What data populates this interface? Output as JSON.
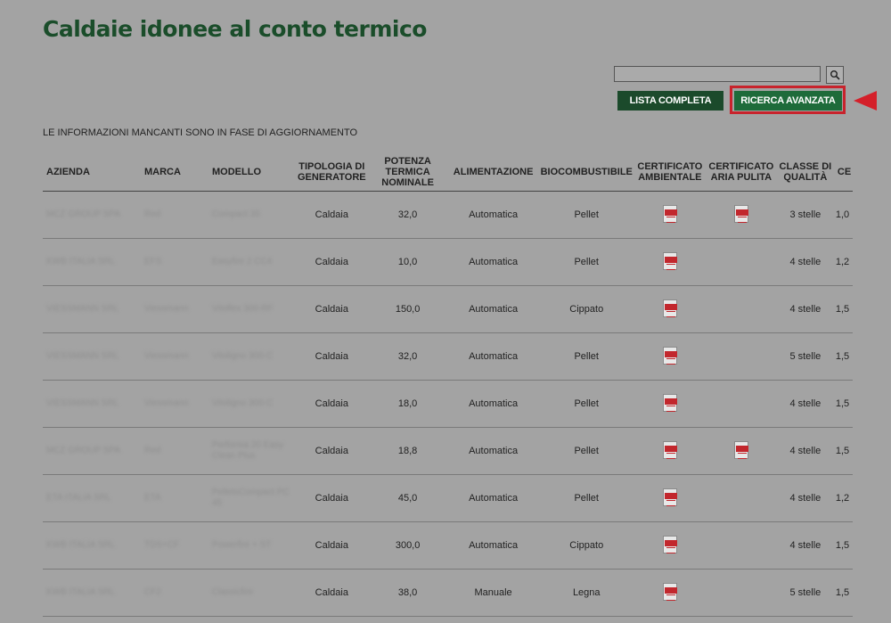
{
  "page": {
    "title": "Caldaie idonee al conto termico",
    "notice": "LE INFORMAZIONI MANCANTI SONO IN FASE DI AGGIORNAMENTO"
  },
  "search": {
    "value": "",
    "placeholder": "",
    "button_icon": "magnifier-icon"
  },
  "buttons": {
    "lista": "LISTA COMPLETA",
    "ricerca": "RICERCA AVANZATA"
  },
  "colors": {
    "brand_green": "#1b4a2b",
    "highlight_red": "#c8232c",
    "background": "#a3a3a3"
  },
  "table": {
    "headers": {
      "azienda": "AZIENDA",
      "marca": "MARCA",
      "modello": "MODELLO",
      "tipologia": "TIPOLOGIA DI GENERATORE",
      "potenza": "POTENZA TERMICA NOMINALE",
      "alimentazione": "ALIMENTAZIONE",
      "biocombustibile": "BIOCOMBUSTIBILE",
      "cert_ambientale": "CERTIFICATO AMBIENTALE",
      "cert_aria": "CERTIFICATO ARIA PULITA",
      "classe": "CLASSE DI QUALITÀ",
      "ce": "CE"
    },
    "rows": [
      {
        "azienda": "MCZ GROUP SPA",
        "marca": "Red",
        "modello": "Compact 35",
        "tipologia": "Caldaia",
        "potenza": "32,0",
        "alimentazione": "Automatica",
        "biocombustibile": "Pellet",
        "cert_ambientale": true,
        "cert_aria": true,
        "classe": "3 stelle",
        "ce": "1,0"
      },
      {
        "azienda": "KWB ITALIA SRL",
        "marca": "EFS",
        "modello": "Easyfire 2 CC4",
        "tipologia": "Caldaia",
        "potenza": "10,0",
        "alimentazione": "Automatica",
        "biocombustibile": "Pellet",
        "cert_ambientale": true,
        "cert_aria": false,
        "classe": "4 stelle",
        "ce": "1,2"
      },
      {
        "azienda": "VIESSMANN SRL",
        "marca": "Viessmann",
        "modello": "Vitoflex 300-RF",
        "tipologia": "Caldaia",
        "potenza": "150,0",
        "alimentazione": "Automatica",
        "biocombustibile": "Cippato",
        "cert_ambientale": true,
        "cert_aria": false,
        "classe": "4 stelle",
        "ce": "1,5"
      },
      {
        "azienda": "VIESSMANN SRL",
        "marca": "Viessmann",
        "modello": "Vitoligno 300-C",
        "tipologia": "Caldaia",
        "potenza": "32,0",
        "alimentazione": "Automatica",
        "biocombustibile": "Pellet",
        "cert_ambientale": true,
        "cert_aria": false,
        "classe": "5 stelle",
        "ce": "1,5"
      },
      {
        "azienda": "VIESSMANN SRL",
        "marca": "Viessmann",
        "modello": "Vitoligno 300-C",
        "tipologia": "Caldaia",
        "potenza": "18,0",
        "alimentazione": "Automatica",
        "biocombustibile": "Pellet",
        "cert_ambientale": true,
        "cert_aria": false,
        "classe": "4 stelle",
        "ce": "1,5"
      },
      {
        "azienda": "MCZ GROUP SPA",
        "marca": "Red",
        "modello": "Performa 20 Easy Clean Plus",
        "tipologia": "Caldaia",
        "potenza": "18,8",
        "alimentazione": "Automatica",
        "biocombustibile": "Pellet",
        "cert_ambientale": true,
        "cert_aria": true,
        "classe": "4 stelle",
        "ce": "1,5"
      },
      {
        "azienda": "ETA ITALIA SRL",
        "marca": "ETA",
        "modello": "PelletsCompact PC 45",
        "tipologia": "Caldaia",
        "potenza": "45,0",
        "alimentazione": "Automatica",
        "biocombustibile": "Pellet",
        "cert_ambientale": true,
        "cert_aria": false,
        "classe": "4 stelle",
        "ce": "1,2"
      },
      {
        "azienda": "KWB ITALIA SRL",
        "marca": "TDS+CF",
        "modello": "Powerfire + ST",
        "tipologia": "Caldaia",
        "potenza": "300,0",
        "alimentazione": "Automatica",
        "biocombustibile": "Cippato",
        "cert_ambientale": true,
        "cert_aria": false,
        "classe": "4 stelle",
        "ce": "1,5"
      },
      {
        "azienda": "KWB ITALIA SRL",
        "marca": "CF2",
        "modello": "Classicfire",
        "tipologia": "Caldaia",
        "potenza": "38,0",
        "alimentazione": "Manuale",
        "biocombustibile": "Legna",
        "cert_ambientale": true,
        "cert_aria": false,
        "classe": "5 stelle",
        "ce": "1,5"
      }
    ]
  }
}
